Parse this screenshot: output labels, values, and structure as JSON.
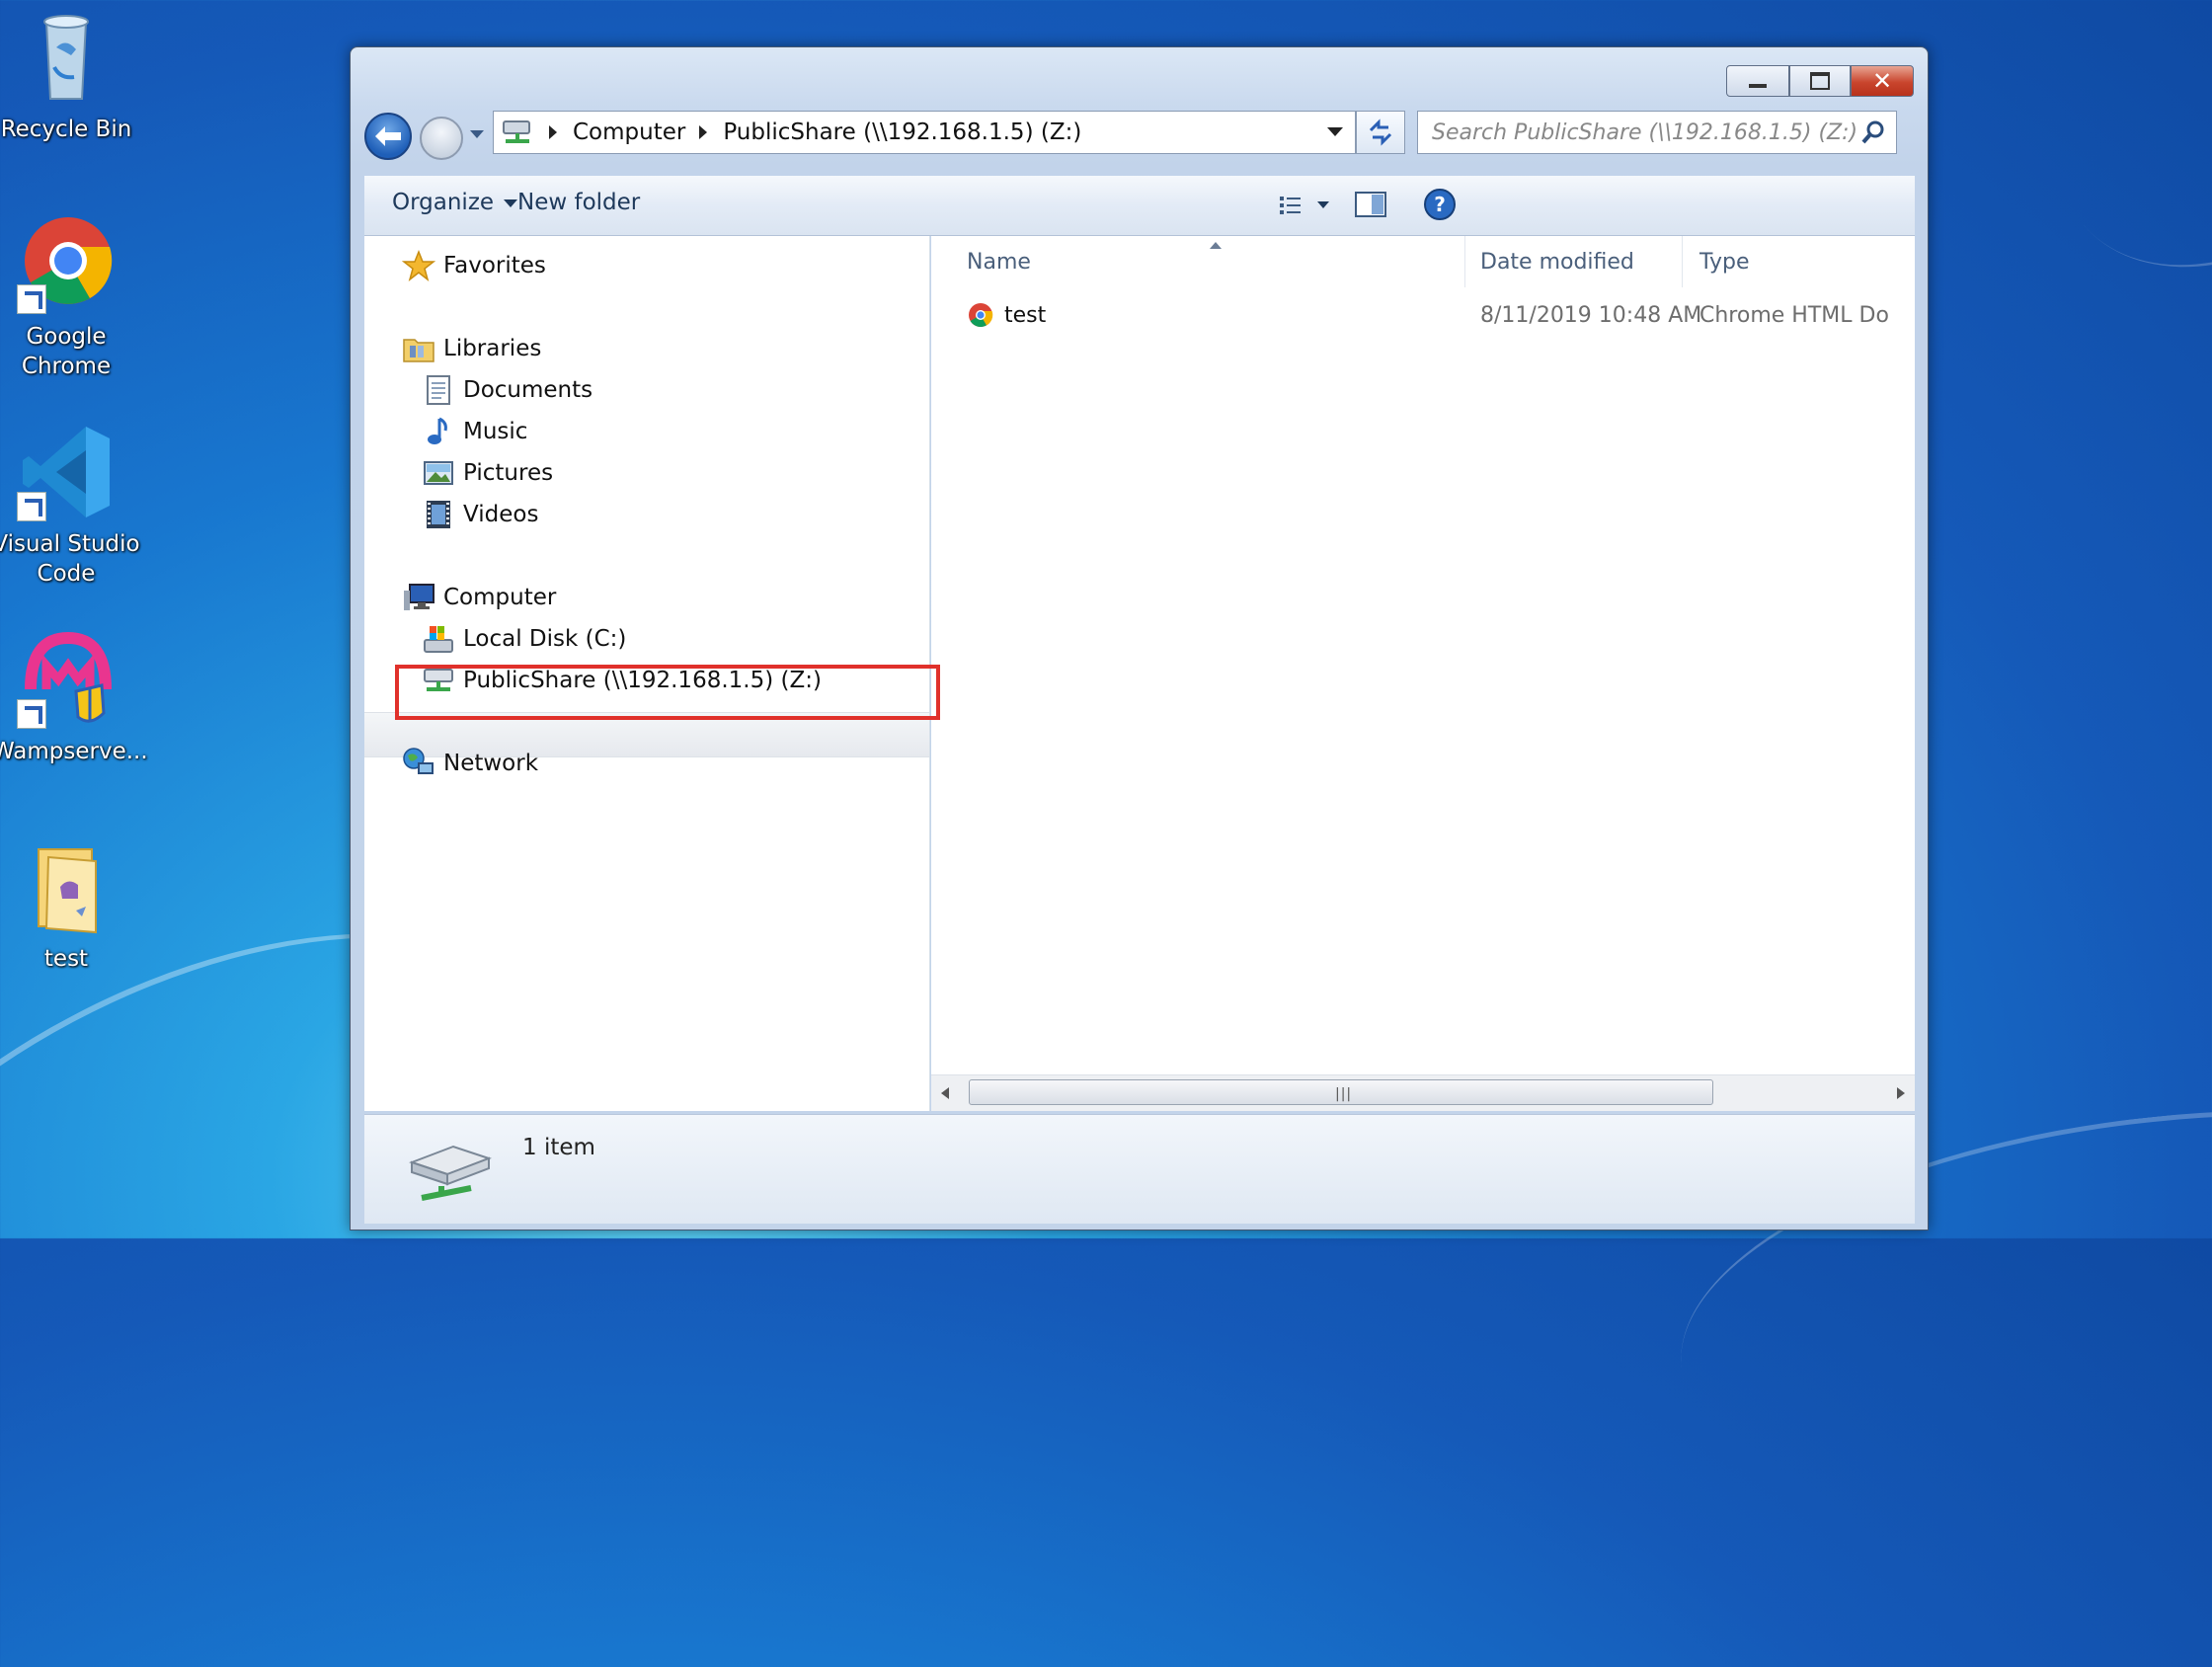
{
  "desktop": {
    "icons": [
      {
        "label": "Recycle Bin",
        "icon": "recycle-bin-icon"
      },
      {
        "label": "Google Chrome",
        "icon": "chrome-icon"
      },
      {
        "label": "Visual Studio Code",
        "icon": "vscode-icon"
      },
      {
        "label": "Wampserve...",
        "icon": "wampserver-icon"
      },
      {
        "label": "test",
        "icon": "folder-icon"
      }
    ]
  },
  "window": {
    "nav": {
      "breadcrumb": [
        "Computer",
        "PublicShare (\\\\192.168.1.5) (Z:)"
      ],
      "search_placeholder": "Search PublicShare (\\\\192.168.1.5) (Z:)"
    },
    "commands": {
      "organize": "Organize",
      "new_folder": "New folder"
    },
    "nav_pane": {
      "favorites": "Favorites",
      "libraries": "Libraries",
      "library_items": [
        "Documents",
        "Music",
        "Pictures",
        "Videos"
      ],
      "computer": "Computer",
      "drives": [
        "Local Disk (C:)",
        "PublicShare (\\\\192.168.1.5) (Z:)"
      ],
      "network": "Network"
    },
    "columns": [
      "Name",
      "Date modified",
      "Type"
    ],
    "files": [
      {
        "name": "test",
        "date": "8/11/2019 10:48 AM",
        "type": "Chrome HTML Do"
      }
    ],
    "status": "1 item"
  },
  "colors": {
    "highlight_box": "#e0312b",
    "selection": "#e6e9ee"
  }
}
